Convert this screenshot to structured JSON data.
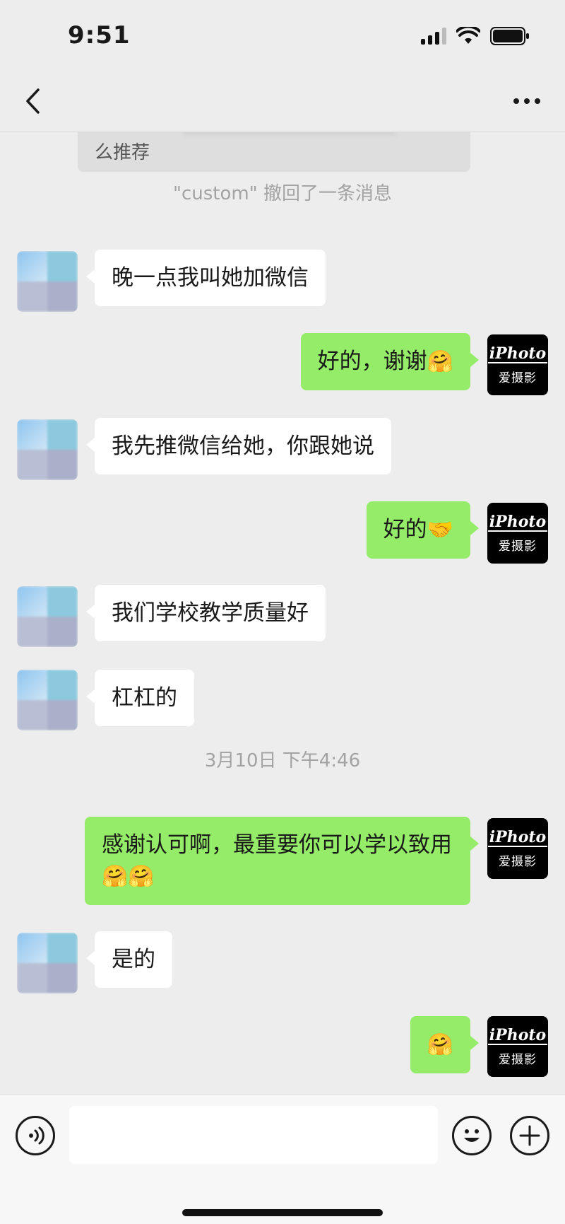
{
  "status_bar": {
    "time": "9:51"
  },
  "nav": {
    "back_icon": "chevron-left-icon",
    "more_icon": "more-dots-icon"
  },
  "quoted_text": "么推荐",
  "system_notice": "\"custom\" 撤回了一条消息",
  "timestamp": "3月10日 下午4:46",
  "avatar_logo": {
    "mark": "iPhoto",
    "text": "爱摄影"
  },
  "messages": [
    {
      "side": "left",
      "text": "晚一点我叫她加微信"
    },
    {
      "side": "right",
      "text": "好的，谢谢",
      "emoji": "🤗"
    },
    {
      "side": "left",
      "text": "我先推微信给她，你跟她说"
    },
    {
      "side": "right",
      "text": "好的",
      "emoji": "🤝"
    },
    {
      "side": "left",
      "text": "我们学校教学质量好"
    },
    {
      "side": "left",
      "text": "杠杠的"
    },
    {
      "side": "right",
      "text": "感谢认可啊，最重要你可以学以致用",
      "emoji": "🤗🤗"
    },
    {
      "side": "left",
      "text": "是的"
    },
    {
      "side": "right",
      "text": "",
      "emoji": "🤗"
    }
  ],
  "input_bar": {
    "voice_icon": "voice-icon",
    "emoji_icon": "smiley-icon",
    "plus_icon": "plus-icon",
    "input_value": ""
  },
  "colors": {
    "bubble_self": "#95ec69",
    "bubble_other": "#ffffff",
    "background": "#ededed"
  }
}
